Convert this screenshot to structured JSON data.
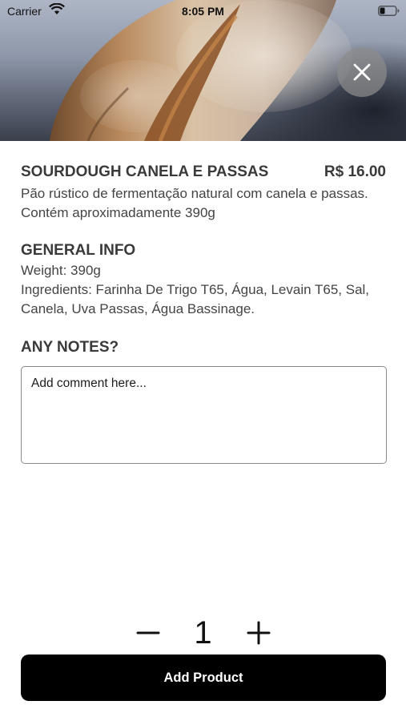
{
  "status_bar": {
    "carrier": "Carrier",
    "time": "8:05 PM"
  },
  "product": {
    "title": "SOURDOUGH CANELA E PASSAS",
    "price": "R$ 16.00",
    "description": "Pão rústico de fermentação natural com canela e passas. Contém aproximadamente 390g"
  },
  "general_info": {
    "heading": "GENERAL INFO",
    "weight": "Weight: 390g",
    "ingredients": "Ingredients: Farinha De Trigo T65, Água, Levain T65, Sal, Canela, Uva Passas, Água Bassinage."
  },
  "notes": {
    "heading": "ANY NOTES?",
    "placeholder": "Add comment here..."
  },
  "quantity": {
    "value": "1"
  },
  "add_button": {
    "label": "Add Product"
  }
}
